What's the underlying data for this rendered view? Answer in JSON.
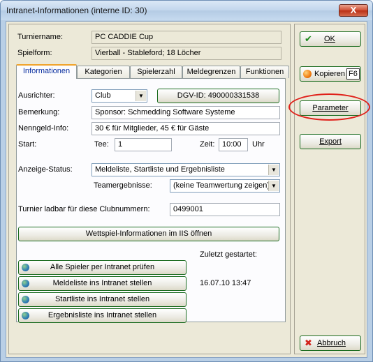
{
  "window": {
    "title": "Intranet-Informationen (interne ID: 30)",
    "close_label": "X"
  },
  "header": {
    "turniername_label": "Turniername:",
    "turniername_value": "PC CADDIE Cup",
    "spielform_label": "Spielform:",
    "spielform_value": "Vierball - Stableford; 18 Löcher"
  },
  "tabs": [
    {
      "label": "Informationen",
      "active": true
    },
    {
      "label": "Kategorien",
      "active": false
    },
    {
      "label": "Spielerzahl",
      "active": false
    },
    {
      "label": "Meldegrenzen",
      "active": false
    },
    {
      "label": "Funktionen",
      "active": false
    }
  ],
  "info": {
    "ausrichter_label": "Ausrichter:",
    "ausrichter_value": "Club",
    "dgv_button": "DGV-ID: 490000331538",
    "bemerkung_label": "Bemerkung:",
    "bemerkung_value": "Sponsor: Schmedding Software Systeme",
    "nenngeld_label": "Nenngeld-Info:",
    "nenngeld_value": "30 € für Mitglieder, 45 € für Gäste",
    "start_label": "Start:",
    "tee_label": "Tee:",
    "tee_value": "1",
    "zeit_label": "Zeit:",
    "zeit_value": "10:00",
    "uhr_label": "Uhr",
    "anzeige_label": "Anzeige-Status:",
    "anzeige_value": "Meldeliste, Startliste und Ergebnisliste",
    "team_label": "Teamergebnisse:",
    "team_value": "(keine Teamwertung zeigen)",
    "ladbar_label": "Turnier ladbar für diese Clubnummern:",
    "ladbar_value": "0499001",
    "iis_button": "Wettspiel-Informationen im IIS öffnen",
    "zuletzt_label": "Zuletzt gestartet:",
    "zuletzt_value": "16.07.10 13:47",
    "actions": [
      "Alle Spieler per Intranet prüfen",
      "Meldeliste ins Intranet stellen",
      "Startliste ins Intranet stellen",
      "Ergebnisliste ins Intranet stellen"
    ]
  },
  "side": {
    "ok": "OK",
    "kopieren": "Kopieren",
    "kopieren_key": "F6",
    "parameter": "Parameter",
    "export": "Export",
    "abbruch": "Abbruch"
  },
  "colors": {
    "button_border": "#1a6b1f",
    "highlight": "#e0201a",
    "active_tab_text": "#0a2fa0"
  }
}
